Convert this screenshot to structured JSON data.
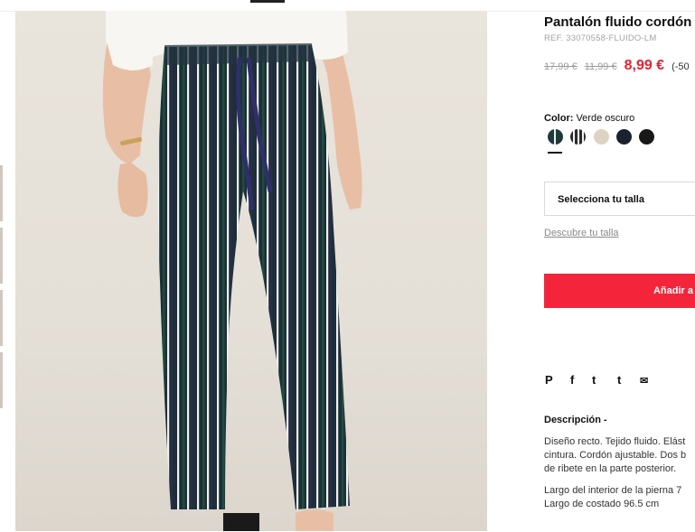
{
  "product": {
    "title": "Pantalón fluido cordón",
    "ref": "REF. 33070558-FLUIDO-LM",
    "price_original": "17,99 €",
    "price_previous": "11,99 €",
    "price_current": "8,99 €",
    "discount": "(-50"
  },
  "color": {
    "label": "Color:",
    "value": "Verde oscuro",
    "swatches": [
      {
        "name": "verde-oscuro-rayas",
        "color": "#1f3a3a",
        "selected": true
      },
      {
        "name": "negro-rayas",
        "color": "#2a2a2a",
        "selected": false
      },
      {
        "name": "beige",
        "color": "#ddd3c2",
        "selected": false
      },
      {
        "name": "marino",
        "color": "#1a2230",
        "selected": false
      },
      {
        "name": "negro",
        "color": "#181818",
        "selected": false
      }
    ]
  },
  "size": {
    "select_label": "Selecciona tu talla",
    "guide_link": "Descubre tu talla"
  },
  "cart": {
    "add_label": "Añadir a"
  },
  "social": {
    "icons": [
      "pinterest-icon",
      "facebook-icon",
      "twitter-icon",
      "tumblr-icon",
      "email-icon"
    ],
    "glyphs": [
      "P",
      "f",
      "t",
      "t",
      "✉"
    ]
  },
  "description": {
    "title": "Descripción -",
    "lines1": [
      "Diseño recto. Tejido fluido. Elást",
      "cintura. Cordón ajustable. Dos b",
      "de ribete en la parte posterior."
    ],
    "lines2": [
      "Largo del interior de la pierna 7",
      "Largo de costado 96.5 cm"
    ]
  },
  "colors": {
    "accent": "#f4253b",
    "price": "#e5202e"
  }
}
